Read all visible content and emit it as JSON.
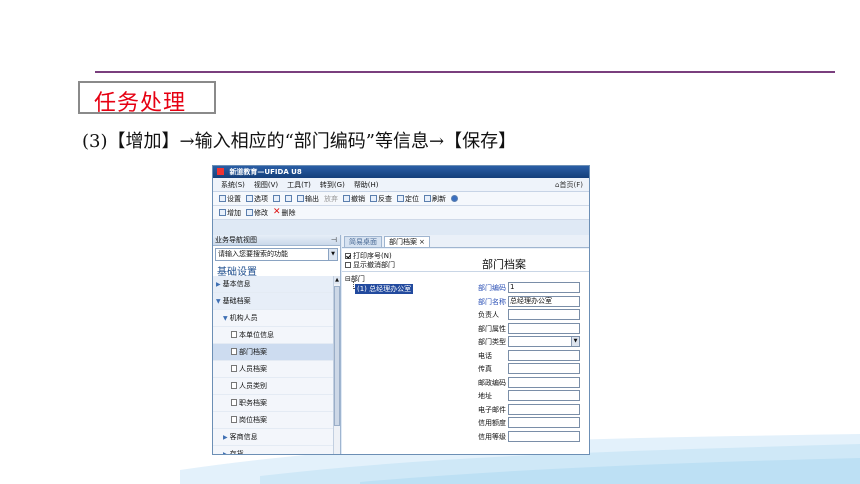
{
  "slide": {
    "section_title": "任务处理",
    "instruction": "(3)【增加】→输入相应的“部门编码”等信息→【保存】"
  },
  "window": {
    "title": "新道教育—UFIDA U8",
    "menu": [
      "系统(S)",
      "视图(V)",
      "工具(T)",
      "转到(G)",
      "帮助(H)"
    ],
    "home": "首页(F)",
    "toolbar1": [
      "设置",
      "选项",
      "",
      "输出",
      "放弃",
      "",
      "撤销",
      "反查",
      "定位",
      "刷新"
    ],
    "toolbar2": [
      "增加",
      "修改",
      "删除"
    ]
  },
  "sidebar": {
    "header": "业务导航视图",
    "search_placeholder": "请输入您要搜索的功能",
    "section": "基础设置",
    "items": [
      {
        "label": "基本信息"
      },
      {
        "label": "基础档案"
      },
      {
        "label": "机构人员"
      },
      {
        "label": "本单位信息"
      },
      {
        "label": "部门档案"
      },
      {
        "label": "人员档案"
      },
      {
        "label": "人员类别"
      },
      {
        "label": "职务档案"
      },
      {
        "label": "岗位档案"
      },
      {
        "label": "客商信息"
      },
      {
        "label": "存货"
      }
    ]
  },
  "tabs": [
    {
      "label": "简易桌面"
    },
    {
      "label": "部门档案"
    }
  ],
  "content": {
    "title": "部门档案",
    "options": [
      "打印序号(N)",
      "显示撤消部门"
    ],
    "tree_root": "部门",
    "tree_node": "(1) 总经理办公室",
    "fields": [
      {
        "label": "部门编码",
        "value": "1"
      },
      {
        "label": "部门名称",
        "value": "总经理办公室"
      },
      {
        "label": "负责人",
        "value": ""
      },
      {
        "label": "部门属性",
        "value": ""
      },
      {
        "label": "部门类型",
        "value": ""
      },
      {
        "label": "电话",
        "value": ""
      },
      {
        "label": "传真",
        "value": ""
      },
      {
        "label": "邮政编码",
        "value": ""
      },
      {
        "label": "地址",
        "value": ""
      },
      {
        "label": "电子邮件",
        "value": ""
      },
      {
        "label": "信用额度",
        "value": ""
      },
      {
        "label": "信用等级",
        "value": ""
      }
    ]
  },
  "colors": {
    "accent_rule": "#7a3f7e",
    "section_title": "#e60012",
    "titlebar": "#1f4f90",
    "selection": "#224a9e"
  }
}
